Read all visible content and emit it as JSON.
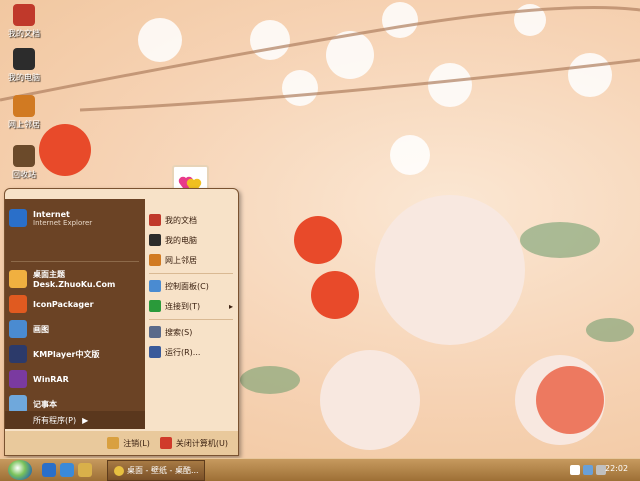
{
  "desktop_icons": [
    {
      "label": "我的文档",
      "color": "#c0392b"
    },
    {
      "label": "我的电脑",
      "color": "#2c2c2c"
    },
    {
      "label": "网上邻居",
      "color": "#d17a22"
    },
    {
      "label": "回收站",
      "color": "#6b4a2a"
    }
  ],
  "start_menu": {
    "left_items": [
      {
        "name": "Internet",
        "desc": "Internet Explorer",
        "color": "#2a6fc9"
      },
      {
        "name": "桌面主题Desk.ZhuoKu.Com",
        "desc": "",
        "color": "#f0b040"
      },
      {
        "name": "IconPackager",
        "desc": "",
        "color": "#e05a20"
      },
      {
        "name": "画图",
        "desc": "",
        "color": "#4a8bd1"
      },
      {
        "name": "KMPlayer中文版",
        "desc": "",
        "color": "#2c3a6a"
      },
      {
        "name": "WinRAR",
        "desc": "",
        "color": "#7a3aa0"
      },
      {
        "name": "记事本",
        "desc": "",
        "color": "#6fa8dc"
      }
    ],
    "all_programs": "所有程序(P)",
    "right_items": [
      {
        "label": "我的文档",
        "color": "#c0392b"
      },
      {
        "label": "我的电脑",
        "color": "#2c2c2c"
      },
      {
        "label": "网上邻居",
        "color": "#d17a22"
      },
      {
        "label": "控制面板(C)",
        "color": "#4a8bd1"
      },
      {
        "label": "连接到(T)",
        "color": "#2a9a3a"
      },
      {
        "label": "搜索(S)",
        "color": "#5a6a8a"
      },
      {
        "label": "运行(R)...",
        "color": "#3a5a9a"
      }
    ],
    "logoff": "注销(L)",
    "shutdown": "关闭计算机(U)"
  },
  "taskbar": {
    "task_button": "桌面 - 壁纸 - 桌酷...",
    "clock": "22:02"
  }
}
